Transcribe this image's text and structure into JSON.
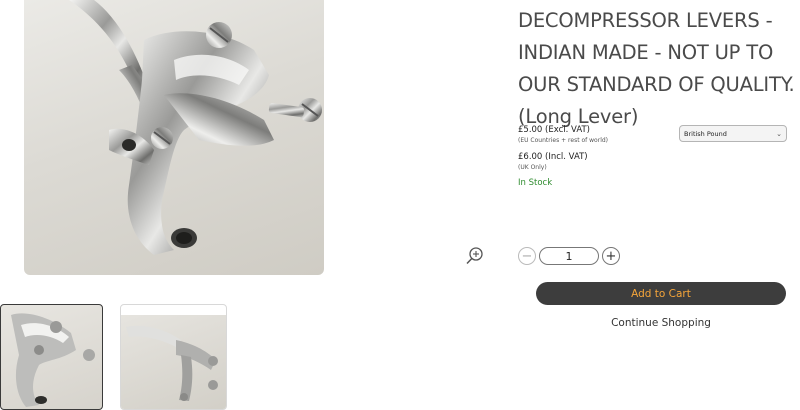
{
  "product": {
    "title": "DECOMPRESSOR LEVERS - INDIAN MADE - NOT UP TO OUR STANDARD OF QUALITY. (Long Lever)",
    "main_image_alt": "Decompressor lever product photo"
  },
  "pricing": {
    "excl_vat": "£5.00 (Excl. VAT)",
    "excl_vat_note": "(EU Countries + rest of world)",
    "incl_vat": "£6.00 (Incl. VAT)",
    "incl_vat_note": "(UK Only)",
    "stock_status": "In Stock",
    "stock_color": "#2e8b2e"
  },
  "currency": {
    "selected": "British Pound",
    "icon": "chevron-down-icon"
  },
  "quantity": {
    "value": "1",
    "minus_symbol": "−",
    "plus_symbol": "+"
  },
  "actions": {
    "add_to_cart": "Add to Cart",
    "continue_shopping": "Continue Shopping",
    "zoom_icon": "zoom-in-icon"
  },
  "gallery": {
    "thumbnails": [
      {
        "selected": true
      },
      {
        "selected": false
      }
    ]
  },
  "colors": {
    "button_bg": "#3d3d3d",
    "button_text": "#f5a53a"
  }
}
